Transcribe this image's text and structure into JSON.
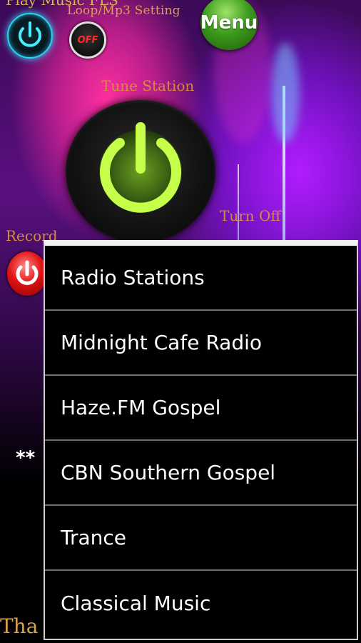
{
  "labels": {
    "top_cut": "Play Music FLS",
    "loop_setting": "Loop/Mp3 Setting",
    "tune_station": "Tune Station",
    "turn_off": "Turn Off",
    "record": "Record",
    "stars": "**",
    "bottom_cut": "Tha"
  },
  "buttons": {
    "menu": "Menu",
    "off_toggle": "OFF"
  },
  "icons": {
    "power_small": "power-icon",
    "power_large": "power-icon",
    "record": "power-icon"
  },
  "colors": {
    "label_orange": "#d58d3a",
    "menu_green": "#3c9b1c",
    "tune_glow": "#b8ff2a",
    "small_power_glow": "#35e0ff",
    "record_red": "#e01414"
  },
  "menu_popup": {
    "items": [
      "Radio Stations",
      "Midnight Cafe Radio",
      "Haze.FM Gospel",
      "CBN Southern Gospel",
      "Trance",
      "Classical Music"
    ]
  }
}
